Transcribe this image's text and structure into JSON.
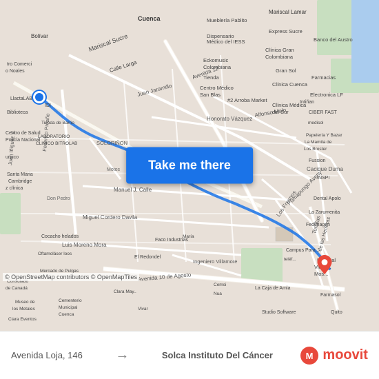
{
  "map": {
    "background_color": "#e8e0d8",
    "copyright": "© OpenStreetMap contributors © OpenMapTiles"
  },
  "button": {
    "label": "Take me there"
  },
  "bottom_bar": {
    "from_label": "Avenida Loja, 146",
    "arrow": "→",
    "to_label": "Solca Instituto Del Cáncer"
  },
  "logo": {
    "text": "moovit"
  },
  "colors": {
    "accent_blue": "#1a73e8",
    "accent_red": "#e8483b",
    "road_main": "#ffffff",
    "road_secondary": "#f5f0e8",
    "map_bg": "#e8e0d8"
  }
}
